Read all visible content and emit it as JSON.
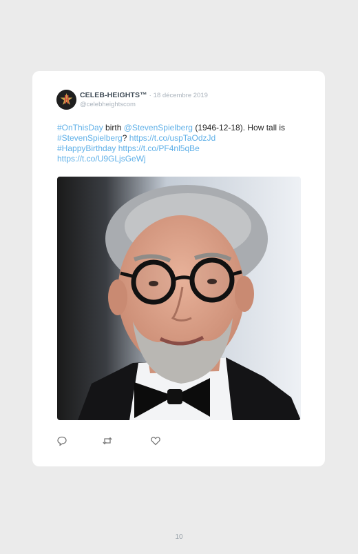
{
  "tweet": {
    "author_name": "CELEB-HEIGHTS™",
    "separator": "·",
    "date": "18 décembre 2019",
    "handle": "@celebheightscom",
    "text": {
      "hashtag_1": "#OnThisDay",
      "word_birth": "birth",
      "mention": "@StevenSpielberg",
      "birthdate_question": "(1946-12-18). How tall is",
      "hashtag_2": "#StevenSpielberg",
      "question_mark": "?",
      "link_1": "https://t.co/uspTaOdzJd",
      "hashtag_3": "#HappyBirthday",
      "link_2": "https://t.co/PF4nl5qBe",
      "link_3": "https://t.co/U9GLjsGeWj"
    },
    "actions": [
      "reply-icon",
      "retweet-icon",
      "like-icon"
    ]
  },
  "colors": {
    "page_background": "#ebebeb",
    "card_background": "#ffffff",
    "link": "#5fb0e8",
    "muted": "#aab3bc",
    "name": "#3e4a55"
  },
  "footer": {
    "page_number": "10"
  }
}
